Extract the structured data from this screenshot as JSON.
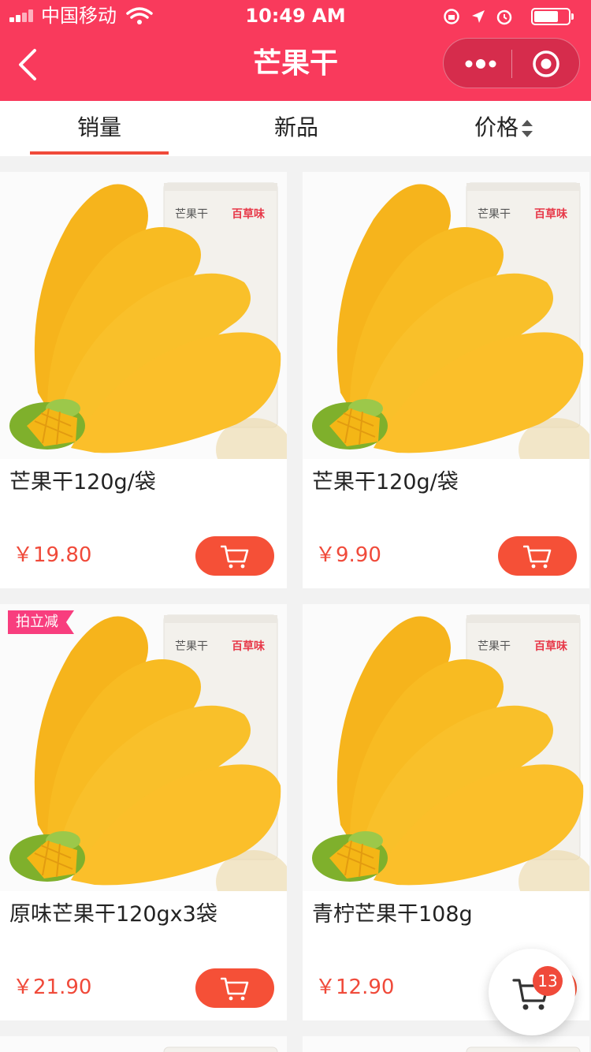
{
  "status_bar": {
    "carrier": "中国移动",
    "time": "10:49 AM"
  },
  "nav": {
    "title": "芒果干"
  },
  "tabs": [
    {
      "label": "销量",
      "active": true
    },
    {
      "label": "新品",
      "active": false
    },
    {
      "label": "价格",
      "active": false
    }
  ],
  "products": [
    {
      "name": "芒果干120g/袋",
      "price": "￥19.80",
      "tag": ""
    },
    {
      "name": "芒果干120g/袋",
      "price": "￥9.90",
      "tag": ""
    },
    {
      "name": "原味芒果干120gx3袋",
      "price": "￥21.90",
      "tag": "拍立减"
    },
    {
      "name": "青柠芒果干108g",
      "price": "￥12.90",
      "tag": ""
    }
  ],
  "package_text": {
    "title": "芒果干",
    "brand": "百草味"
  },
  "cart": {
    "count": "13"
  },
  "colors": {
    "accent": "#f93a5c",
    "price": "#f04a3a",
    "cart_button": "#f55037",
    "promo_tag": "#f83e7e"
  }
}
